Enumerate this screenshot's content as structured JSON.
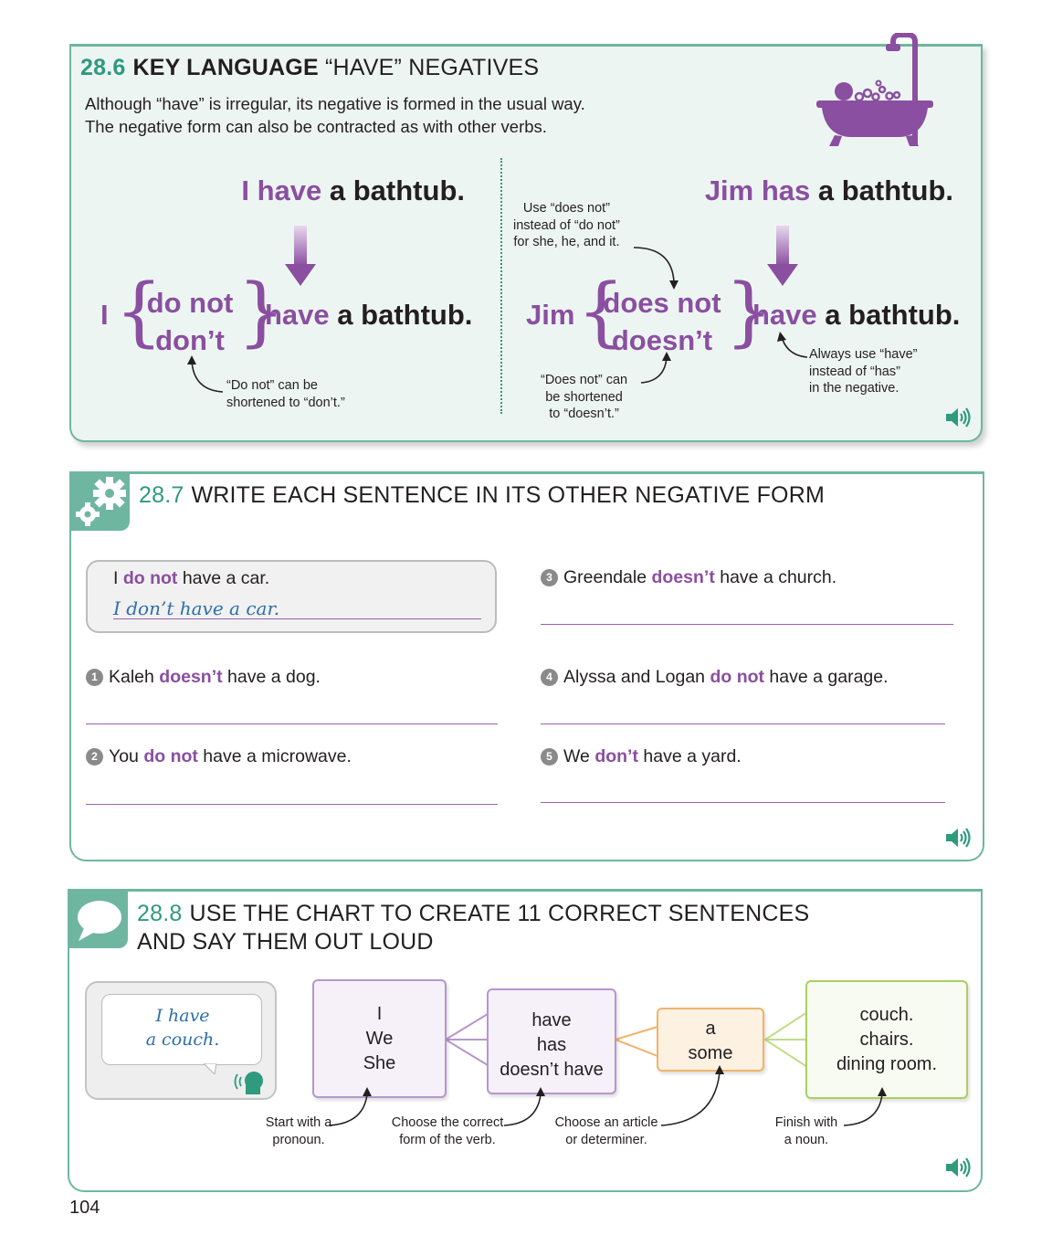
{
  "sec86": {
    "number": "28.6",
    "title_bold": "KEY LANGUAGE",
    "title_rest": "“HAVE” NEGATIVES",
    "intro_line1": "Although “have” is irregular, its negative is formed in the usual way.",
    "intro_line2": "The negative form can also be contracted as with other verbs.",
    "left": {
      "subject_have": "I have",
      "object": "a bathtub.",
      "neg_subject": "I",
      "neg_full": "do not",
      "neg_short": "don’t",
      "verb": "have",
      "object2": "a bathtub.",
      "note_line1": "“Do not” can be",
      "note_line2": "shortened to “don’t.”"
    },
    "right": {
      "subject_has": "Jim has",
      "object": "a bathtub.",
      "neg_subject": "Jim",
      "neg_full": "does not",
      "neg_short": "doesn’t",
      "verb": "have",
      "object2": "a bathtub.",
      "note_top_line1": "Use “does not”",
      "note_top_line2": "instead of “do not”",
      "note_top_line3": "for she, he, and it.",
      "note_bottom_line1": "“Does not” can",
      "note_bottom_line2": "be shortened",
      "note_bottom_line3": "to “doesn’t.”",
      "note_have_line1": "Always use “have”",
      "note_have_line2": "instead of “has”",
      "note_have_line3": "in the negative."
    },
    "icon": "bathtub-icon"
  },
  "sec87": {
    "number": "28.7",
    "title": "WRITE EACH SENTENCE IN ITS OTHER NEGATIVE FORM",
    "example": {
      "pre": "I ",
      "neg": "do not",
      "post": " have a car.",
      "answer": "I don’t have a car."
    },
    "items": [
      {
        "num": "1",
        "pre": "Kaleh ",
        "neg": "doesn’t",
        "post": " have a dog."
      },
      {
        "num": "2",
        "pre": "You ",
        "neg": "do not",
        "post": " have a microwave."
      },
      {
        "num": "3",
        "pre": "Greendale ",
        "neg": "doesn’t",
        "post": " have a church."
      },
      {
        "num": "4",
        "pre": "Alyssa and Logan ",
        "neg": "do not",
        "post": " have a garage."
      },
      {
        "num": "5",
        "pre": "We ",
        "neg": "don’t",
        "post": " have a yard."
      }
    ]
  },
  "sec88": {
    "number": "28.8",
    "title_line1": "USE THE CHART TO CREATE 11 CORRECT SENTENCES",
    "title_line2": "AND SAY THEM OUT LOUD",
    "example_line1": "I have",
    "example_line2": "a couch.",
    "boxes": {
      "pronouns": [
        "I",
        "We",
        "She"
      ],
      "verbs": [
        "have",
        "has",
        "doesn’t have"
      ],
      "articles": [
        "a",
        "some"
      ],
      "nouns": [
        "couch.",
        "chairs.",
        "dining room."
      ]
    },
    "notes": {
      "pronoun_line1": "Start with a",
      "pronoun_line2": "pronoun.",
      "verb_line1": "Choose the correct",
      "verb_line2": "form of the verb.",
      "article_line1": "Choose an article",
      "article_line2": "or determiner.",
      "noun_line1": "Finish with",
      "noun_line2": "a noun."
    },
    "colors": {
      "purple": "#8a4fa0",
      "teal": "#2e9a7e",
      "orange": "#f0b36a",
      "green": "#a9cf63"
    }
  },
  "page_number": "104"
}
